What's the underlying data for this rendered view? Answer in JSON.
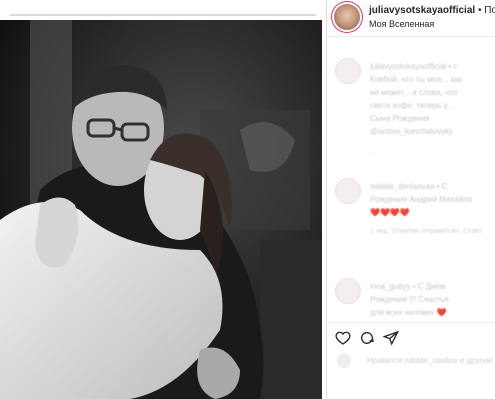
{
  "post": {
    "username": "juliavysotskayaofficial",
    "follow_text": "• По",
    "location": "Моя Вселенная"
  },
  "comments": [
    {
      "lines": [
        "juliavysotskayaofficial • с",
        "Ковбой, что ты моя... как",
        "не может... а слова, что",
        "свете кофе, теперь у...",
        "Сына Рождения",
        "@andrei_konchalovsky"
      ],
      "meta": "..."
    },
    {
      "lines": [
        "natalia_denisovaa • С",
        "Рождения Андрей Махайло",
        "❤️❤️❤️❤️"
      ],
      "meta": "1 нед.   Отметки «Нравится»:   Ответ"
    },
    {
      "lines": [
        "inna_gultyy • С Днём",
        "Рождения !!! Счастья",
        "для всех человек ❤️"
      ],
      "meta": ""
    }
  ],
  "likes_text": "Нравится natalie_rawlins и другим",
  "icons": [
    "heart-icon",
    "comment-icon",
    "share-icon"
  ]
}
